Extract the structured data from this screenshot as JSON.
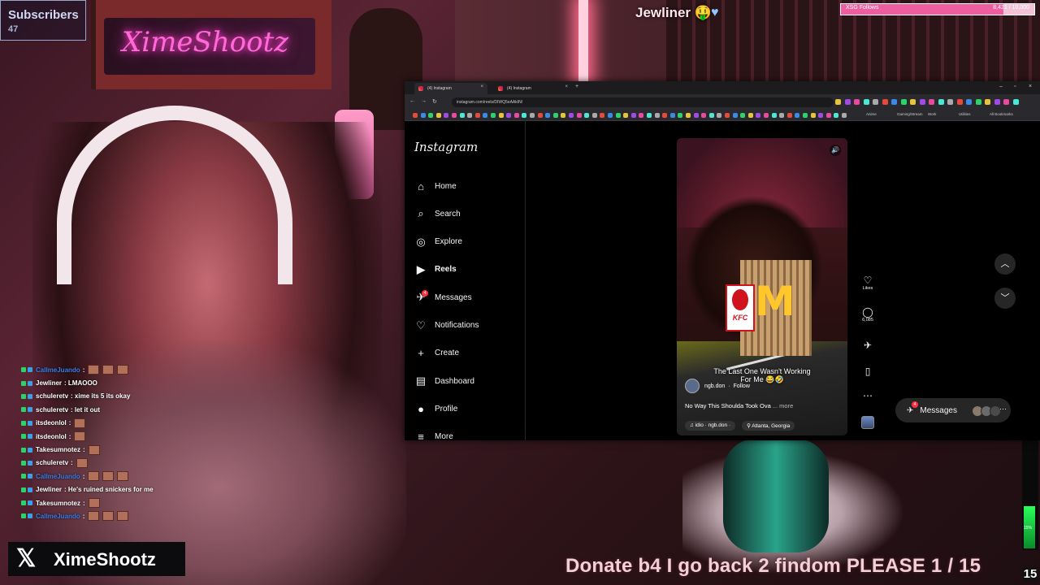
{
  "overlay": {
    "subscribers_label": "Subscribers",
    "subscribers_count": "47",
    "ticker_name": "Jewliner",
    "ticker_emoji": "🤑",
    "goal_label": "XSG Follows",
    "goal_count": "8,421 / 10,000",
    "goal_fraction": 0.842,
    "neon_sign": "XimeShootz",
    "x_handle": "XimeShootz",
    "donate_text": "Donate b4 I go back 2 findom PLEASE  1 / 15",
    "meter_level": 0.3,
    "meter_number": "15",
    "meter_pct_label": "15%"
  },
  "chat": [
    {
      "user": "CallmeJuando",
      "color": "#3d7de8",
      "msg": ":",
      "emotes": 3
    },
    {
      "user": "Jewliner",
      "color": "#ffffff",
      "msg": ": LMAOOO",
      "emotes": 0
    },
    {
      "user": "schuleretv",
      "color": "#ffffff",
      "msg": ": xime its 5 its okay",
      "emotes": 0
    },
    {
      "user": "schuleretv",
      "color": "#ffffff",
      "msg": ": let it out",
      "emotes": 0
    },
    {
      "user": "itsdeonlol",
      "color": "#ffffff",
      "msg": ":",
      "emotes": 1
    },
    {
      "user": "itsdeonlol",
      "color": "#ffffff",
      "msg": ":",
      "emotes": 1
    },
    {
      "user": "Takesumnotez",
      "color": "#ffffff",
      "msg": ":",
      "emotes": 1
    },
    {
      "user": "schuleretv",
      "color": "#ffffff",
      "msg": ":",
      "emotes": 1
    },
    {
      "user": "CallmeJuando",
      "color": "#3d7de8",
      "msg": ":",
      "emotes": 3
    },
    {
      "user": "Jewliner",
      "color": "#ffffff",
      "msg": ": He's ruined snickers for me",
      "emotes": 0
    },
    {
      "user": "Takesumnotez",
      "color": "#ffffff",
      "msg": ":",
      "emotes": 1
    },
    {
      "user": "CallmeJuando",
      "color": "#3d7de8",
      "msg": ":",
      "emotes": 3
    }
  ],
  "browser": {
    "tabs": [
      "(4) Instagram",
      "(4) Instagram"
    ],
    "url": "instagram.com/reels/DIWQ5eAAkIN/",
    "bookmark_labels": [
      "Anime",
      "Gaming/Stream",
      "Work",
      "Utilities",
      "All Bookmarks"
    ]
  },
  "instagram": {
    "logo": "Instagram",
    "nav": [
      {
        "icon": "home-icon",
        "glyph": "⌂",
        "label": "Home"
      },
      {
        "icon": "search-icon",
        "glyph": "⌕",
        "label": "Search"
      },
      {
        "icon": "explore-icon",
        "glyph": "◎",
        "label": "Explore"
      },
      {
        "icon": "reels-icon",
        "glyph": "▶",
        "label": "Reels"
      },
      {
        "icon": "messages-icon",
        "glyph": "✈",
        "label": "Messages",
        "badge": "4"
      },
      {
        "icon": "notifications-icon",
        "glyph": "♡",
        "label": "Notifications"
      },
      {
        "icon": "create-icon",
        "glyph": "+",
        "label": "Create"
      },
      {
        "icon": "dashboard-icon",
        "glyph": "▤",
        "label": "Dashboard"
      },
      {
        "icon": "profile-icon",
        "glyph": "●",
        "label": "Profile"
      },
      {
        "icon": "more-icon",
        "glyph": "≡",
        "label": "More"
      }
    ],
    "reel": {
      "overlay_caption": "The Last One Wasn't Working For Me 😂🤣",
      "author": "ngb.don",
      "follow": "Follow",
      "description": "No Way This Shoulda Took Ova",
      "more": "... more",
      "audio": "idio · ngb.don ·",
      "location": "Atlanta, Georgia",
      "kfc": "KFC"
    },
    "actions": {
      "likes_label": "Likes",
      "comments_count": "6,085"
    },
    "messages_pill": {
      "label": "Messages",
      "badge": "4"
    }
  }
}
